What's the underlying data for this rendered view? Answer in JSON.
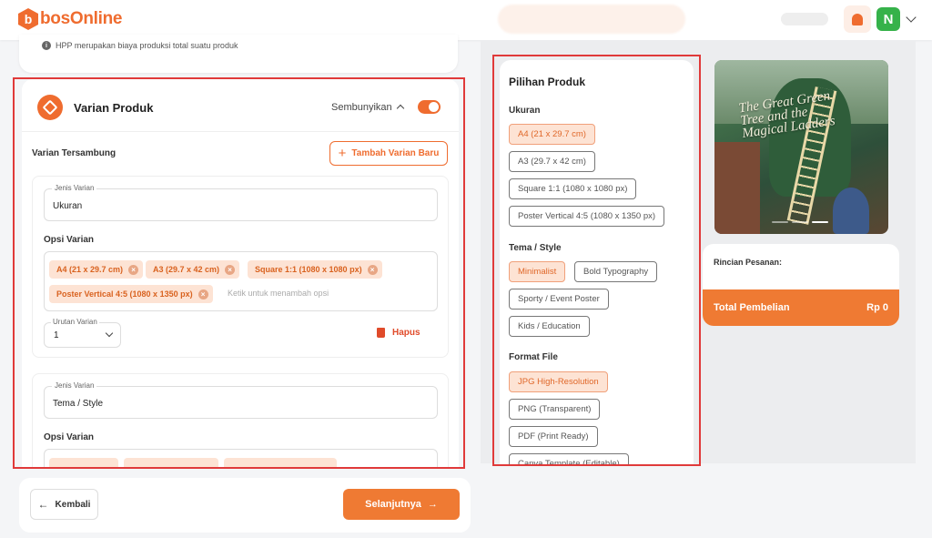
{
  "header": {
    "logo_letter": "b",
    "logo_text": "bosOnline",
    "user_initial": "N",
    "icons": [
      "bell-icon",
      "chevron-down-icon"
    ]
  },
  "info": {
    "hpp_note": "HPP merupakan biaya produksi total suatu produk"
  },
  "varian": {
    "title": "Varian Produk",
    "hide_label": "Sembunyikan",
    "toggle_on": true,
    "connected_label": "Varian Tersambung",
    "add_button": "Tambah Varian Baru",
    "groups": [
      {
        "type_label": "Jenis Varian",
        "type_value": "Ukuran",
        "options_label": "Opsi Varian",
        "chips": [
          "A4 (21 x 29.7 cm)",
          "A3 (29.7 x 42 cm)",
          "Square 1:1 (1080 x 1080 px)",
          "Poster Vertical 4:5 (1080 x 1350 px)"
        ],
        "chip_placeholder": "Ketik untuk menambah opsi",
        "order_label": "Urutan Varian",
        "order_value": "1",
        "delete_label": "Hapus"
      },
      {
        "type_label": "Jenis Varian",
        "type_value": "Tema / Style",
        "options_label": "Opsi Varian"
      }
    ]
  },
  "footer": {
    "back_label": "Kembali",
    "next_label": "Selanjutnya"
  },
  "pilihan": {
    "title": "Pilihan Produk",
    "sections": [
      {
        "label": "Ukuran",
        "options": [
          "A4 (21 x 29.7 cm)",
          "A3 (29.7 x 42 cm)",
          "Square 1:1 (1080 x 1080 px)",
          "Poster Vertical 4:5 (1080 x 1350 px)"
        ],
        "selected": 0
      },
      {
        "label": "Tema / Style",
        "options": [
          "Minimalist",
          "Bold Typography",
          "Sporty / Event Poster",
          "Kids / Education"
        ],
        "selected": 0
      },
      {
        "label": "Format File",
        "options": [
          "JPG High-Resolution",
          "PNG (Transparent)",
          "PDF (Print Ready)",
          "Canva Template (Editable)"
        ],
        "selected": 0
      }
    ]
  },
  "preview": {
    "book_title": "The Great Green Tree and the Magical Ladders"
  },
  "order": {
    "details_label": "Rincian Pesanan:",
    "total_label": "Total Pembelian",
    "total_value": "Rp 0"
  },
  "colors": {
    "accent": "#ef6c2f",
    "highlight_border": "#e03a3a",
    "chip_bg": "#fde3d4"
  }
}
